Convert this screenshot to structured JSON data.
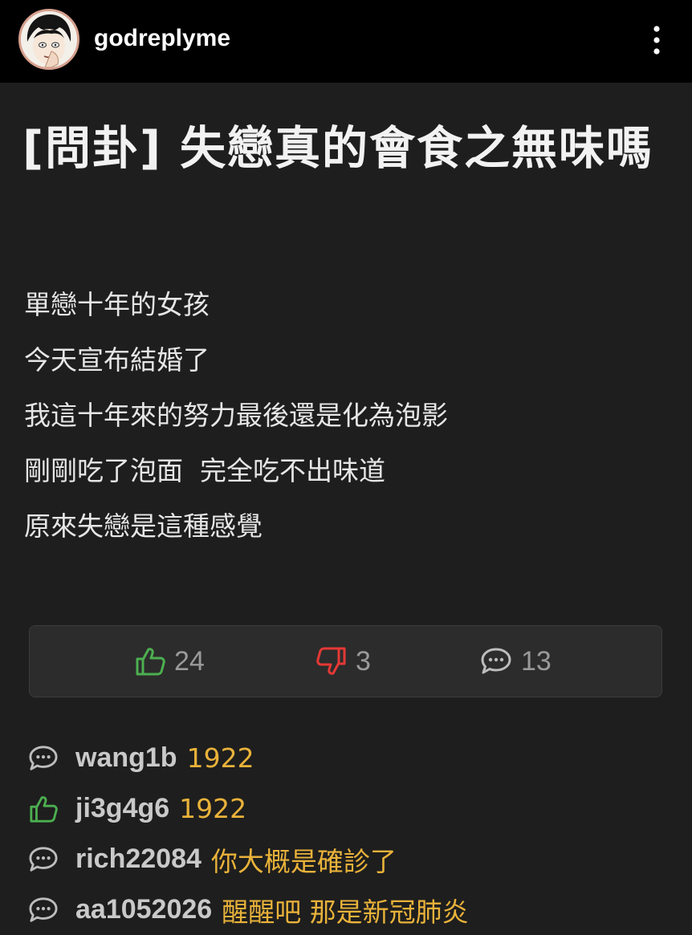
{
  "header": {
    "username": "godreplyme",
    "avatar_icon": "cartoon-face-avatar",
    "menu_icon": "more-vertical-icon"
  },
  "post": {
    "title": "[問卦] 失戀真的會食之無味嗎",
    "body_lines": [
      "單戀十年的女孩",
      "今天宣布結婚了",
      "我這十年來的努力最後還是化為泡影",
      "剛剛吃了泡面  完全吃不出味道",
      "原來失戀是這種感覺"
    ]
  },
  "stats": {
    "likes": "24",
    "dislikes": "3",
    "comments": "13"
  },
  "comments": [
    {
      "type": "comment",
      "icon": "speech-bubble-icon",
      "user": "wang1b",
      "text": "1922"
    },
    {
      "type": "push",
      "icon": "thumbs-up-icon",
      "user": "ji3g4g6",
      "text": "1922"
    },
    {
      "type": "comment",
      "icon": "speech-bubble-icon",
      "user": "rich22084",
      "text": "你大概是確診了"
    },
    {
      "type": "comment",
      "icon": "speech-bubble-icon",
      "user": "aa1052026",
      "text": "醒醒吧 那是新冠肺炎"
    }
  ],
  "colors": {
    "background": "#1e1e1e",
    "header_background": "#000000",
    "like_green": "#4caf50",
    "dislike_red": "#e53935",
    "comment_text": "#e9b23a",
    "username_gray": "#c9c9c9"
  }
}
